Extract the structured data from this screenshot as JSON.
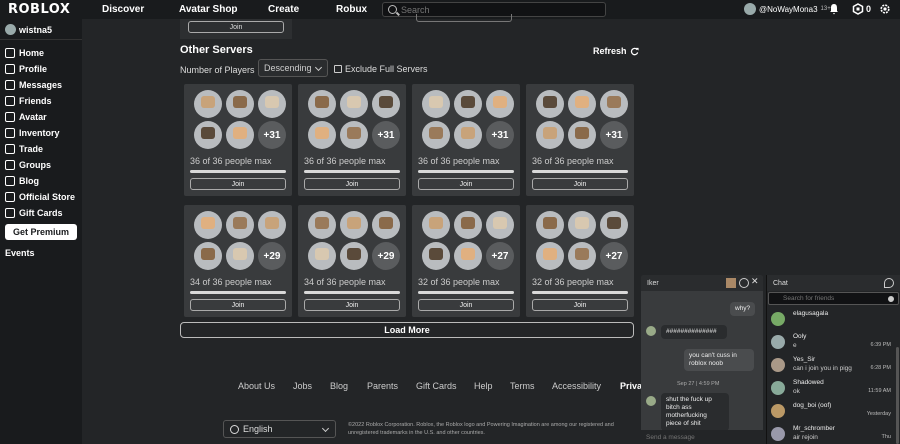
{
  "topbar": {
    "logo": "ROBLOX",
    "nav": [
      "Discover",
      "Avatar Shop",
      "Create",
      "Robux"
    ],
    "search_placeholder": "Search",
    "username": "@NoWayMona3",
    "age": "13+",
    "robux": "0"
  },
  "sidebar": {
    "username": "wistna5",
    "items": [
      {
        "label": "Home",
        "icon": "home-icon"
      },
      {
        "label": "Profile",
        "icon": "profile-icon"
      },
      {
        "label": "Messages",
        "icon": "messages-icon"
      },
      {
        "label": "Friends",
        "icon": "friends-icon"
      },
      {
        "label": "Avatar",
        "icon": "avatar-icon"
      },
      {
        "label": "Inventory",
        "icon": "inventory-icon"
      },
      {
        "label": "Trade",
        "icon": "trade-icon"
      },
      {
        "label": "Groups",
        "icon": "groups-icon"
      },
      {
        "label": "Blog",
        "icon": "blog-icon"
      },
      {
        "label": "Official Store",
        "icon": "store-icon"
      },
      {
        "label": "Gift Cards",
        "icon": "giftcard-icon"
      }
    ],
    "premium_label": "Get Premium",
    "events_label": "Events"
  },
  "main": {
    "top_join": "Join",
    "section_title": "Other Servers",
    "refresh_label": "Refresh",
    "filter_label": "Number of Players",
    "sort_value": "Descending",
    "exclude_label": "Exclude Full Servers",
    "servers": [
      {
        "status": "36 of 36 people max",
        "more": "+31",
        "join": "Join"
      },
      {
        "status": "36 of 36 people max",
        "more": "+31",
        "join": "Join"
      },
      {
        "status": "36 of 36 people max",
        "more": "+31",
        "join": "Join"
      },
      {
        "status": "36 of 36 people max",
        "more": "+31",
        "join": "Join"
      },
      {
        "status": "34 of 36 people max",
        "more": "+29",
        "join": "Join"
      },
      {
        "status": "34 of 36 people max",
        "more": "+29",
        "join": "Join"
      },
      {
        "status": "32 of 36 people max",
        "more": "+27",
        "join": "Join"
      },
      {
        "status": "32 of 36 people max",
        "more": "+27",
        "join": "Join"
      }
    ],
    "load_more": "Load More"
  },
  "footer": {
    "links": [
      "About Us",
      "Jobs",
      "Blog",
      "Parents",
      "Gift Cards",
      "Help",
      "Terms",
      "Accessibility",
      "Privacy"
    ],
    "language": "English",
    "legal": "©2022 Roblox Corporation. Roblox, the Roblox logo and Powering Imagination are among our registered and unregistered trademarks in the U.S. and other countries."
  },
  "conversation": {
    "name": "Iker",
    "messages": [
      {
        "text": "why?",
        "mine": true
      },
      {
        "text": "##############",
        "mine": false
      },
      {
        "text": "you can't cuss in roblox noob",
        "mine": true
      },
      {
        "text": "shut the fuck up bitch ass motherfucking piece of shit",
        "mine": false
      }
    ],
    "timestamp": "Sep 27 | 4:59 PM",
    "input_placeholder": "Send a message"
  },
  "chat": {
    "title": "Chat",
    "search_placeholder": "Search for friends",
    "friends": [
      {
        "name": "elagusagala",
        "msg": "",
        "time": ""
      },
      {
        "name": "Ooly",
        "msg": "e",
        "time": "6:39 PM"
      },
      {
        "name": "Yes_Sir",
        "msg": "can i join you in pigg",
        "time": "6:28 PM"
      },
      {
        "name": "Shadowed",
        "msg": "ok",
        "time": "11:59 AM"
      },
      {
        "name": "dog_boi (oof)",
        "msg": "",
        "time": "Yesterday"
      },
      {
        "name": "Mr_schromber",
        "msg": "air rejoin",
        "time": "Thu"
      }
    ]
  },
  "colors": {
    "background": "#232527",
    "panel": "#191b1d",
    "card": "#393b3d",
    "accent_online": "#4aa3df"
  }
}
